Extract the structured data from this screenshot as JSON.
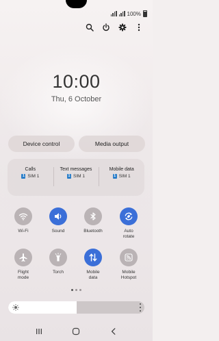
{
  "status": {
    "battery_text": "100%"
  },
  "header": {
    "icons": [
      "search-icon",
      "power-icon",
      "gear-icon",
      "more-vertical-icon"
    ]
  },
  "lockscreen": {
    "time": "10:00",
    "date": "Thu, 6 October"
  },
  "buttons": {
    "device_control": "Device control",
    "media_output": "Media output"
  },
  "sim": {
    "calls": {
      "title": "Calls",
      "value": "SIM 1",
      "badge": "1"
    },
    "messages": {
      "title": "Text messages",
      "value": "SIM 1",
      "badge": "1"
    },
    "data": {
      "title": "Mobile data",
      "value": "SIM 1",
      "badge": "1"
    }
  },
  "tiles": [
    {
      "label": "Wi-Fi",
      "on": false,
      "icon": "wifi-icon"
    },
    {
      "label": "Sound",
      "on": true,
      "icon": "speaker-icon"
    },
    {
      "label": "Bluetooth",
      "on": false,
      "icon": "bluetooth-icon"
    },
    {
      "label": "Auto\nrotate",
      "on": true,
      "icon": "auto-rotate-icon"
    },
    {
      "label": "Flight\nmode",
      "on": false,
      "icon": "airplane-icon"
    },
    {
      "label": "Torch",
      "on": false,
      "icon": "torch-icon"
    },
    {
      "label": "Mobile\ndata",
      "on": true,
      "icon": "data-arrows-icon"
    },
    {
      "label": "Mobile\nHotspot",
      "on": false,
      "icon": "hotspot-icon"
    }
  ],
  "pager": {
    "count": 3,
    "active": 0
  },
  "brightness": {
    "level": 0.5
  },
  "colors": {
    "accent": "#3b6fd8",
    "tile_off": "#bab3b5",
    "sim_badge": "#2c7fc9"
  }
}
